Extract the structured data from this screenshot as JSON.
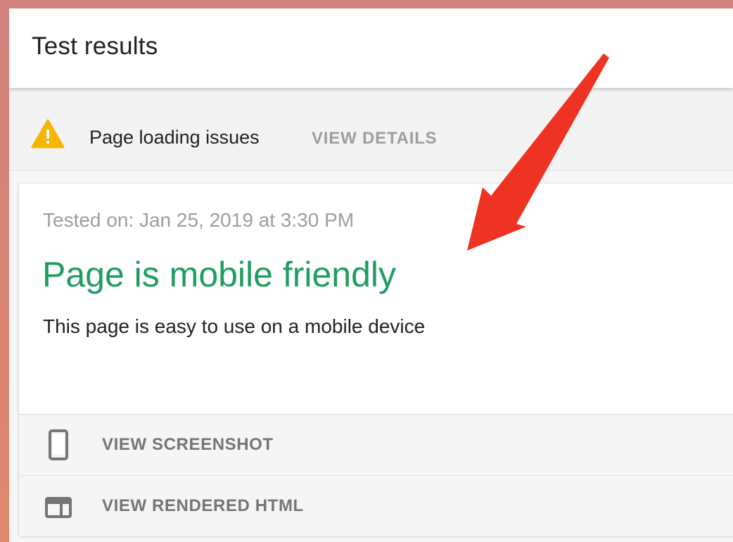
{
  "header": {
    "title": "Test results"
  },
  "issues": {
    "icon": "warning-icon",
    "text": "Page loading issues",
    "action_label": "VIEW DETAILS"
  },
  "result": {
    "tested_on": "Tested on: Jan 25, 2019 at 3:30 PM",
    "title": "Page is mobile friendly",
    "description": "This page is easy to use on a mobile device",
    "title_color": "#1e9e5e"
  },
  "actions": [
    {
      "icon": "phone-icon",
      "label": "VIEW SCREENSHOT"
    },
    {
      "icon": "code-window-icon",
      "label": "VIEW RENDERED HTML"
    }
  ],
  "annotation": {
    "icon": "red-arrow-icon",
    "color": "#ee3322"
  }
}
